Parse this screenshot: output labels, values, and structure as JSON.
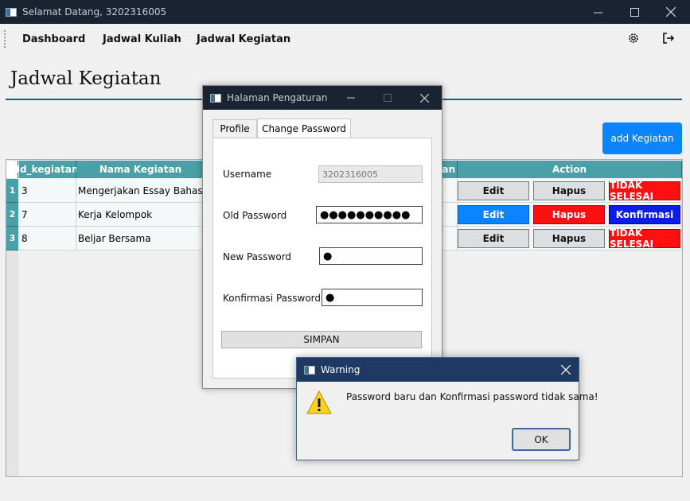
{
  "window": {
    "title": "Selamat Datang, 3202316005",
    "minimize": "—",
    "maximize": "☐",
    "close": "✕"
  },
  "menu": {
    "items": [
      "Dashboard",
      "Jadwal Kuliah",
      "Jadwal Kegiatan"
    ]
  },
  "page": {
    "title": "Jadwal Kegiatan",
    "add_button": "add Kegiatan"
  },
  "table": {
    "headers": [
      "Id_kegiatan",
      "Nama Kegiatan",
      "tan",
      "Action"
    ],
    "rows": [
      {
        "num": "1",
        "id": "3",
        "nama": "Mengerjakan Essay Bahasa Ing",
        "actions": [
          "Edit",
          "Hapus",
          "TIDAK SELESAI"
        ]
      },
      {
        "num": "2",
        "id": "7",
        "nama": "Kerja Kelompok",
        "actions": [
          "Edit",
          "Hapus",
          "Konfirmasi"
        ]
      },
      {
        "num": "3",
        "id": "8",
        "nama": "Beljar Bersama",
        "actions": [
          "Edit",
          "Hapus",
          "TIDAK SELESAI"
        ]
      }
    ]
  },
  "settings_dialog": {
    "title": "Halaman Pengaturan",
    "tabs": [
      "Profile",
      "Change Password"
    ],
    "active_tab": "Change Password",
    "fields": {
      "username_label": "Username",
      "username_value": "3202316005",
      "old_password_label": "Old Password",
      "old_password_value": "●●●●●●●●●●",
      "new_password_label": "New Password",
      "new_password_value": "●",
      "confirm_password_label": "Konfirmasi Password",
      "confirm_password_value": "●"
    },
    "save_button": "SIMPAN"
  },
  "warning_dialog": {
    "title": "Warning",
    "message": "Password baru dan Konfirmasi password tidak sama!",
    "ok_button": "OK"
  }
}
